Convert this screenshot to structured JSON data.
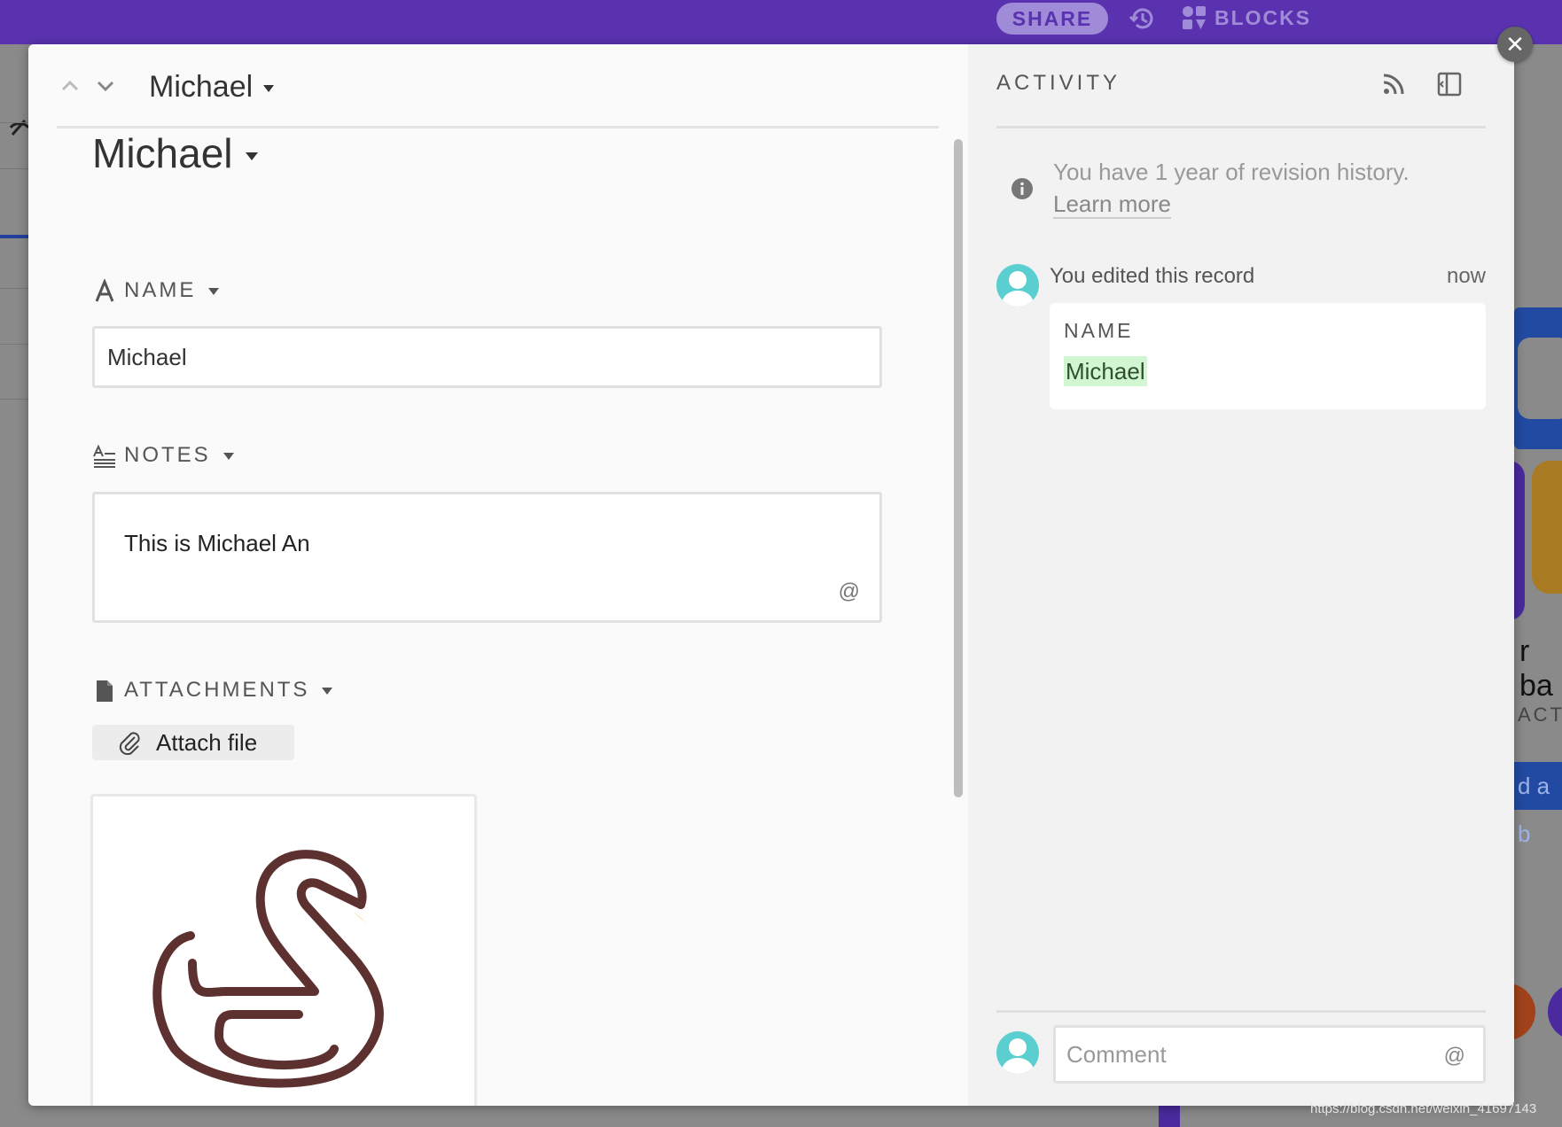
{
  "topbar": {
    "share_label": "SHARE",
    "history_icon": "history-icon",
    "blocks_label": "BLOCKS",
    "blocks_icon": "blocks-icon"
  },
  "background": {
    "right_text_1": "r ba",
    "right_text_2": "ACT",
    "right_button_text": "d a b",
    "watermark": "https://blog.csdn.net/weixin_41697143"
  },
  "modal": {
    "close_label": "✕",
    "header": {
      "record_name": "Michael"
    },
    "title": "Michael",
    "fields": {
      "name": {
        "label": "NAME",
        "value": "Michael"
      },
      "notes": {
        "label": "NOTES",
        "value": "This is Michael An",
        "mention_symbol": "@"
      },
      "attachments": {
        "label": "ATTACHMENTS",
        "button_label": "Attach file"
      }
    }
  },
  "activity": {
    "title": "ACTIVITY",
    "revision_text": "You have 1 year of revision history.",
    "learn_more": "Learn more",
    "event": {
      "text": "You edited this record",
      "time": "now",
      "field_label": "NAME",
      "field_value": "Michael"
    },
    "comment": {
      "placeholder": "Comment",
      "mention_symbol": "@"
    }
  },
  "colors": {
    "topbar": "#5a32b0",
    "avatar": "#5bcfd0",
    "highlight": "#d2f5d2"
  }
}
